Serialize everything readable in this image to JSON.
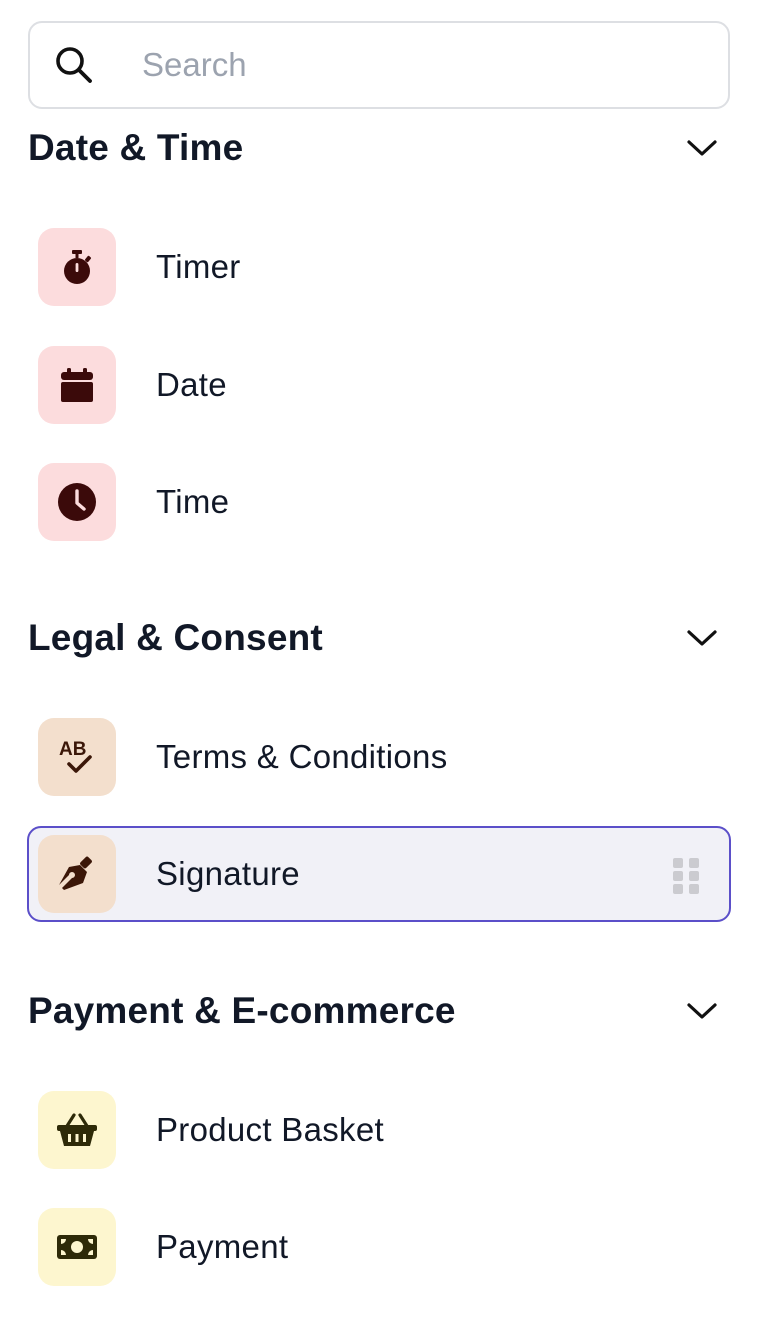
{
  "search": {
    "placeholder": "Search",
    "value": "",
    "icon": "search-icon"
  },
  "sections": [
    {
      "title": "Date & Time",
      "expanded": true,
      "tile_color": "#fcdcdd",
      "icon_color": "#3b0a0a",
      "items": [
        {
          "label": "Timer",
          "icon": "stopwatch-icon"
        },
        {
          "label": "Date",
          "icon": "calendar-icon"
        },
        {
          "label": "Time",
          "icon": "clock-icon"
        }
      ]
    },
    {
      "title": "Legal & Consent",
      "expanded": true,
      "tile_color": "#f3dfcd",
      "icon_color": "#3b1708",
      "items": [
        {
          "label": "Terms & Conditions",
          "icon": "spellcheck-icon",
          "icon_text": "AB"
        },
        {
          "label": "Signature",
          "icon": "pen-nib-icon",
          "selected": true
        }
      ]
    },
    {
      "title": "Payment & E-commerce",
      "expanded": true,
      "tile_color": "#fdf6cf",
      "icon_color": "#2e2a08",
      "items": [
        {
          "label": "Product Basket",
          "icon": "basket-icon"
        },
        {
          "label": "Payment",
          "icon": "banknote-icon"
        }
      ]
    }
  ],
  "colors": {
    "selected_border": "#5b4fc9",
    "selected_background": "#f1f1f7",
    "search_border": "#dddfe3"
  }
}
